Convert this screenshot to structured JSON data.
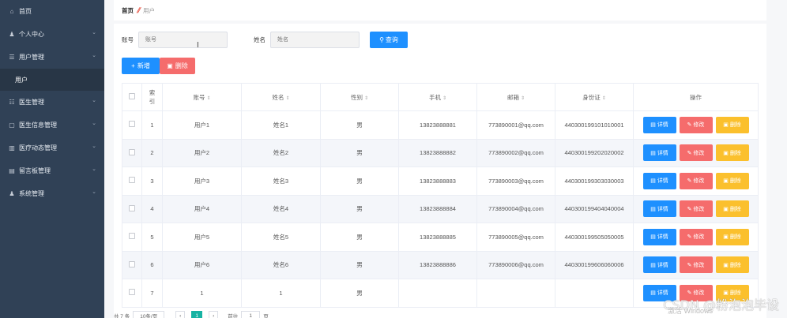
{
  "sidebar": {
    "items": [
      {
        "label": "首页",
        "icon": "home-icon",
        "glyph": "⌂",
        "arrow": false
      },
      {
        "label": "个人中心",
        "icon": "user-icon",
        "glyph": "♟",
        "arrow": true
      },
      {
        "label": "用户管理",
        "icon": "list-icon",
        "glyph": "☰",
        "arrow": true,
        "sub": "用户"
      },
      {
        "label": "医生管理",
        "icon": "doctor-icon",
        "glyph": "☷",
        "arrow": true
      },
      {
        "label": "医生信息管理",
        "icon": "doc-info-icon",
        "glyph": "▢",
        "arrow": true
      },
      {
        "label": "医疗动态管理",
        "icon": "news-icon",
        "glyph": "▥",
        "arrow": true
      },
      {
        "label": "留言板管理",
        "icon": "message-icon",
        "glyph": "▤",
        "arrow": true
      },
      {
        "label": "系统管理",
        "icon": "system-icon",
        "glyph": "♟",
        "arrow": true
      }
    ]
  },
  "breadcrumb": {
    "home": "首页",
    "sep": "⫽",
    "current": "用户"
  },
  "search": {
    "account_label": "账号",
    "account_placeholder": "账号",
    "name_label": "姓名",
    "name_placeholder": "姓名",
    "query_label": "查询"
  },
  "actions": {
    "add_label": "新增",
    "delete_label": "删除"
  },
  "table": {
    "headers": [
      "索引",
      "账号",
      "姓名",
      "性别",
      "手机",
      "邮箱",
      "身份证",
      "操作"
    ],
    "rows": [
      {
        "index": "1",
        "account": "用户1",
        "name": "姓名1",
        "gender": "男",
        "phone": "13823888881",
        "email": "773890001@qq.com",
        "id_card": "440300199101010001"
      },
      {
        "index": "2",
        "account": "用户2",
        "name": "姓名2",
        "gender": "男",
        "phone": "13823888882",
        "email": "773890002@qq.com",
        "id_card": "440300199202020002"
      },
      {
        "index": "3",
        "account": "用户3",
        "name": "姓名3",
        "gender": "男",
        "phone": "13823888883",
        "email": "773890003@qq.com",
        "id_card": "440300199303030003"
      },
      {
        "index": "4",
        "account": "用户4",
        "name": "姓名4",
        "gender": "男",
        "phone": "13823888884",
        "email": "773890004@qq.com",
        "id_card": "440300199404040004"
      },
      {
        "index": "5",
        "account": "用户5",
        "name": "姓名5",
        "gender": "男",
        "phone": "13823888885",
        "email": "773890005@qq.com",
        "id_card": "440300199505050005"
      },
      {
        "index": "6",
        "account": "用户6",
        "name": "姓名6",
        "gender": "男",
        "phone": "13823888886",
        "email": "773890006@qq.com",
        "id_card": "440300199606060006"
      },
      {
        "index": "7",
        "account": "1",
        "name": "1",
        "gender": "男",
        "phone": "",
        "email": "",
        "id_card": ""
      }
    ],
    "op_detail": "详情",
    "op_edit": "修改",
    "op_delete": "删除"
  },
  "pager": {
    "total": "共 7 条",
    "size": "10条/页",
    "page": "1",
    "goto": "前往",
    "goto_value": "1",
    "unit": "页"
  },
  "overlay": {
    "watermark": "CSDN @粉泡泡毕设",
    "windows": "激活 Windows"
  },
  "colors": {
    "sidebar": "#304156",
    "primary": "#1e90ff",
    "danger": "#f56c6c",
    "warning": "#fbc02d",
    "pager_active": "#17b3a3"
  }
}
